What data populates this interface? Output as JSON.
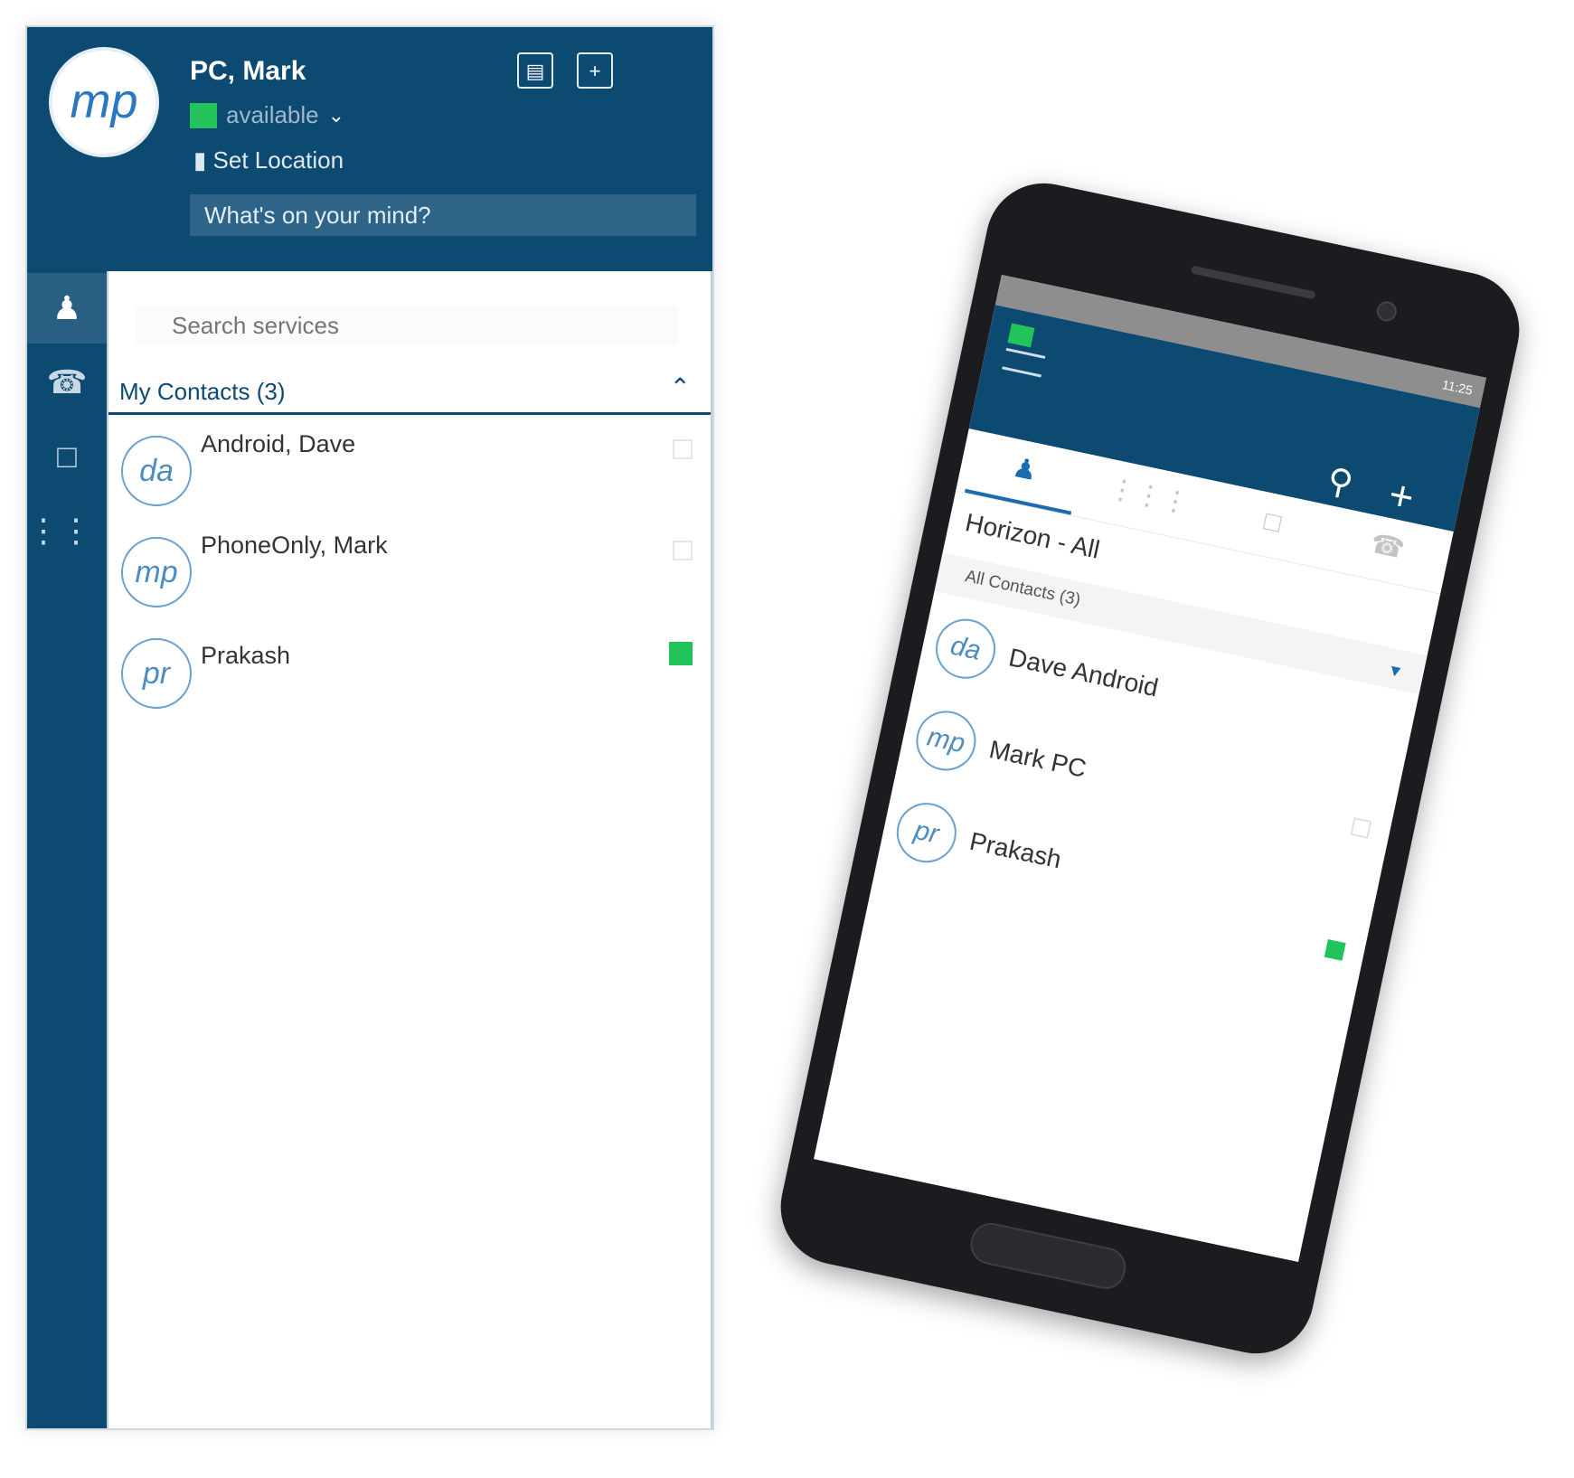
{
  "desktop": {
    "header": {
      "avatar_initials": "mp",
      "user_name": "PC, Mark",
      "presence": "available",
      "presence_color": "#22c35a",
      "location_label": "Set Location",
      "mind_placeholder": "What's on your mind?"
    },
    "search_placeholder": "Search services",
    "section": {
      "label": "My Contacts (3)"
    },
    "contacts": [
      {
        "initials": "da",
        "name": "Android, Dave",
        "online": false
      },
      {
        "initials": "mp",
        "name": "PhoneOnly, Mark",
        "online": false
      },
      {
        "initials": "pr",
        "name": "Prakash",
        "online": true
      }
    ]
  },
  "phone": {
    "status_bar": "11:25",
    "title": "Horizon - All",
    "group_label": "All Contacts (3)",
    "contacts": [
      {
        "initials": "da",
        "name": "Dave Android",
        "online": false
      },
      {
        "initials": "mp",
        "name": "Mark PC",
        "online": false
      },
      {
        "initials": "pr",
        "name": "Prakash",
        "online": true
      }
    ]
  },
  "colors": {
    "brand": "#0d4a72",
    "accent": "#1a6bb0",
    "available": "#22c35a"
  }
}
